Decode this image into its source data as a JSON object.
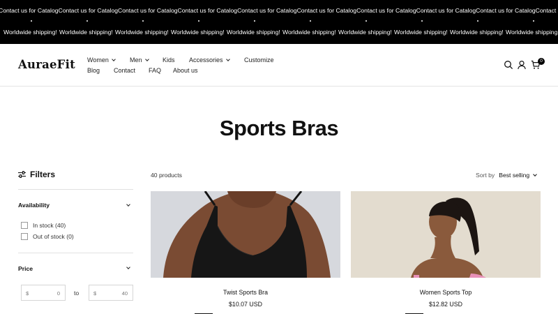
{
  "announcement": {
    "line1": [
      "Contact us for Catalog",
      "Contact us for Catalog",
      "Contact us for Catalog",
      "Contact us for Catalog",
      "Contact us for Catalog",
      "Contact us for Catalog",
      "Contact us for Catalog",
      "Contact us for Catalog",
      "Contact us for Catalog",
      "Contact us for Catalog"
    ],
    "line2": [
      "Worldwide shipping!",
      "Worldwide shipping!",
      "Worldwide shipping!",
      "Worldwide shipping!",
      "Worldwide shipping!",
      "Worldwide shipping!",
      "Worldwide shipping!",
      "Worldwide shipping!",
      "Worldwide shipping!",
      "Worldwide shipping!"
    ]
  },
  "header": {
    "logo": "AuraeFit",
    "nav": {
      "women": "Women",
      "men": "Men",
      "kids": "Kids",
      "accessories": "Accessories",
      "customize": "Customize",
      "blog": "Blog",
      "contact": "Contact",
      "faq": "FAQ",
      "about": "About us"
    },
    "icons": [
      "search-icon",
      "account-icon",
      "cart-icon"
    ],
    "cart_count": "0"
  },
  "page": {
    "title": "Sports Bras"
  },
  "filters": {
    "label": "Filters",
    "availability": {
      "title": "Availability",
      "options": [
        {
          "label": "In stock (40)"
        },
        {
          "label": "Out of stock (0)"
        }
      ]
    },
    "price": {
      "title": "Price",
      "currency": "$",
      "from_value": "0",
      "to_label": "to",
      "to_value": "40"
    }
  },
  "toolbar": {
    "count": "40 products",
    "sort_label": "Sort by",
    "sort_value": "Best selling"
  },
  "products": [
    {
      "name": "Twist Sports Bra",
      "price": "$10.07 USD"
    },
    {
      "name": "Women Sports Top",
      "price": "$12.82 USD"
    }
  ],
  "colors": {
    "topbar": "#000000",
    "text": "#111111",
    "divider": "#e3e3e3"
  }
}
